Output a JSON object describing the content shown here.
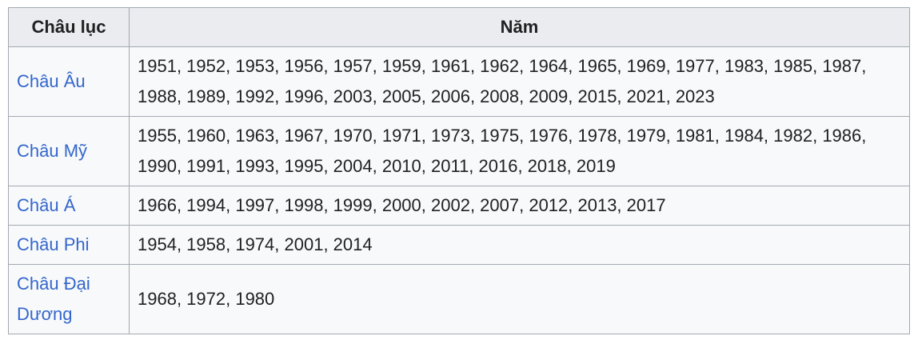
{
  "table": {
    "headers": {
      "continent": "Châu lục",
      "years": "Năm"
    },
    "rows": [
      {
        "continent": "Châu Âu",
        "years": "1951, 1952, 1953, 1956, 1957, 1959, 1961, 1962, 1964, 1965, 1969, 1977, 1983, 1985, 1987, 1988, 1989, 1992, 1996, 2003, 2005, 2006, 2008, 2009, 2015, 2021, 2023"
      },
      {
        "continent": "Châu Mỹ",
        "years": "1955, 1960, 1963, 1967, 1970, 1971, 1973, 1975, 1976, 1978, 1979, 1981, 1984, 1982, 1986, 1990, 1991, 1993, 1995, 2004, 2010, 2011, 2016, 2018, 2019"
      },
      {
        "continent": "Châu Á",
        "years": "1966, 1994, 1997, 1998, 1999, 2000, 2002, 2007, 2012, 2013, 2017"
      },
      {
        "continent": "Châu Phi",
        "years": "1954, 1958, 1974, 2001, 2014"
      },
      {
        "continent": "Châu Đại Dương",
        "years": "1968, 1972, 1980"
      }
    ]
  },
  "colors": {
    "link": "#3366cc",
    "header_bg": "#eaecf0",
    "cell_bg": "#f8f9fa",
    "border": "#a2a9b1",
    "text": "#202122"
  }
}
